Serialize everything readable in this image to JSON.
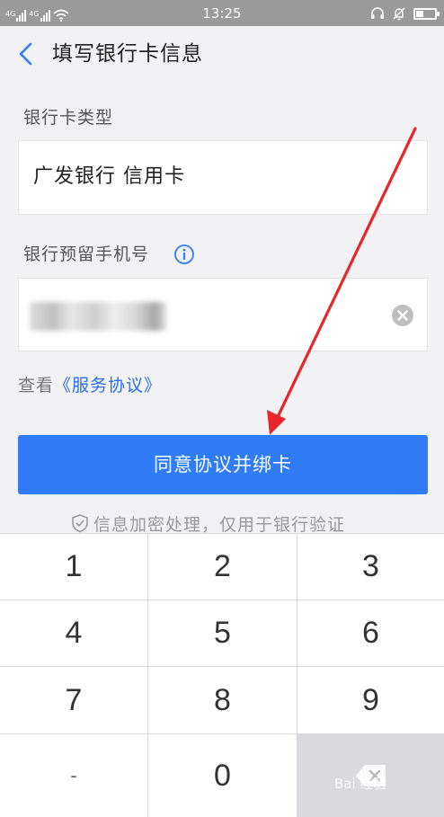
{
  "status_bar": {
    "time": "13:25",
    "sim1_label": "4G",
    "sim2_label": "4G",
    "left_icons": [
      "signal-icon",
      "signal-icon",
      "wifi-icon"
    ],
    "right_icons": [
      "headset-icon",
      "mute-icon",
      "battery-icon"
    ]
  },
  "header": {
    "title": "填写银行卡信息",
    "back_icon": "chevron-left-icon"
  },
  "form": {
    "card_type_label": "银行卡类型",
    "card_type_value": "广发银行 信用卡",
    "phone_label": "银行预留手机号",
    "phone_info_icon": "info-icon",
    "phone_value_masked": true,
    "phone_clear_icon": "clear-icon"
  },
  "terms": {
    "prefix": "查看",
    "link": "《服务协议》"
  },
  "primary_button": {
    "label": "同意协议并绑卡"
  },
  "note": {
    "icon": "shield-icon",
    "text": "信息加密处理，仅用于银行验证"
  },
  "keypad": {
    "keys": [
      "1",
      "2",
      "3",
      "4",
      "5",
      "6",
      "7",
      "8",
      "9",
      "-",
      "0"
    ],
    "delete_icon": "backspace-icon"
  },
  "watermark": {
    "text": "Bai 经验"
  },
  "colors": {
    "accent": "#2f7cf6",
    "link": "#2a6ee8",
    "annotation_arrow": "#e8262b",
    "status_bar_bg": "#9a9a9a"
  }
}
